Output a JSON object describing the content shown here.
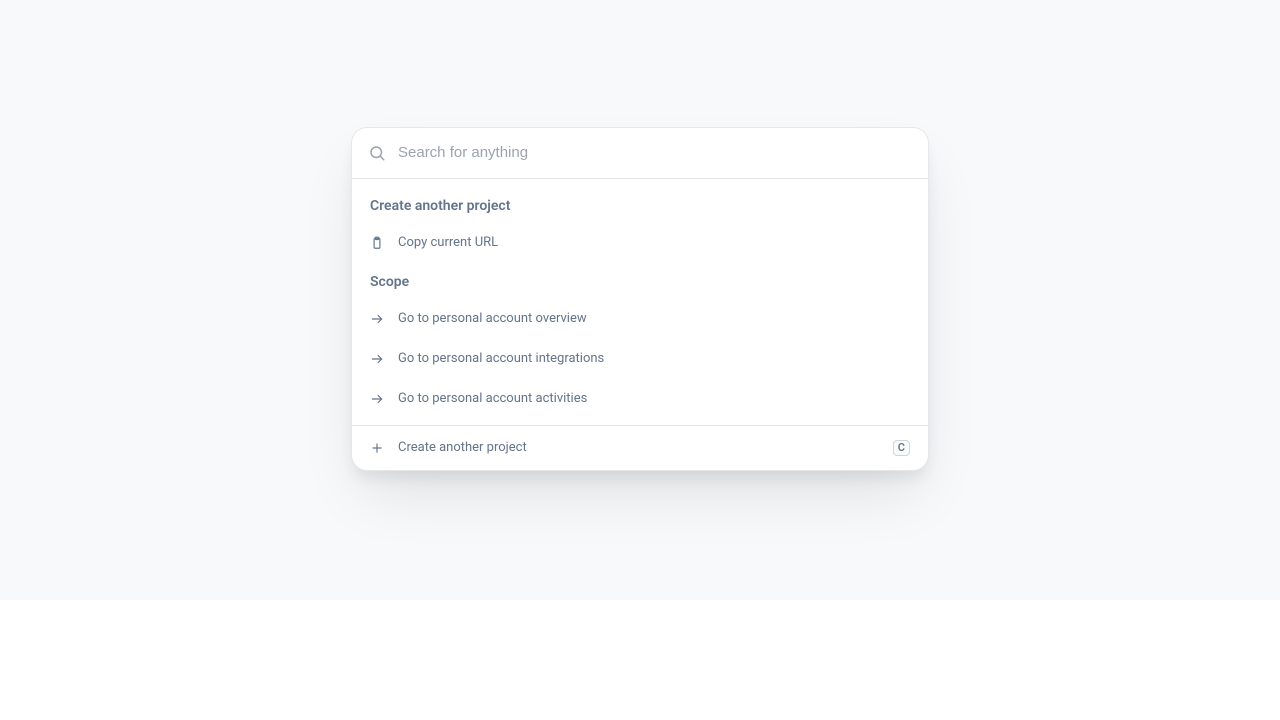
{
  "search": {
    "placeholder": "Search for anything",
    "value": ""
  },
  "sections": {
    "create": {
      "title": "Create another project",
      "items": [
        {
          "icon": "clipboard-icon",
          "label": "Copy current URL"
        }
      ]
    },
    "scope": {
      "title": "Scope",
      "items": [
        {
          "icon": "arrow-right-icon",
          "label": "Go to personal account overview"
        },
        {
          "icon": "arrow-right-icon",
          "label": "Go to personal account integrations"
        },
        {
          "icon": "arrow-right-icon",
          "label": "Go to personal account activities"
        }
      ]
    }
  },
  "footer": {
    "icon": "plus-icon",
    "label": "Create another project",
    "shortcut": "C"
  }
}
